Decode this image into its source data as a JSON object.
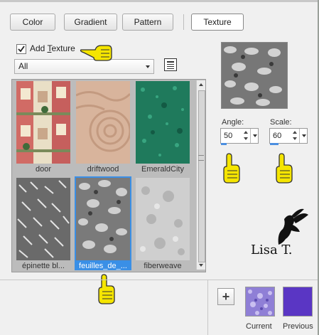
{
  "tabs": [
    {
      "label": "Color"
    },
    {
      "label": "Gradient"
    },
    {
      "label": "Pattern"
    },
    {
      "label": "Texture",
      "active": true
    }
  ],
  "texture": {
    "add_label_prefix": "Add ",
    "add_label_key": "T",
    "add_label_suffix": "exture",
    "checked": true,
    "category": "All"
  },
  "thumbnails": [
    {
      "name": "door",
      "pattern": "door-icon"
    },
    {
      "name": "driftwood",
      "pattern": "driftwood-icon"
    },
    {
      "name": "EmeraldCity",
      "pattern": "emerald-icon"
    },
    {
      "name": "épinette bl...",
      "pattern": "epinette-icon"
    },
    {
      "name": "feuilles_de_...",
      "pattern": "feuilles-icon",
      "selected": true
    },
    {
      "name": "fiberweave",
      "pattern": "fiberweave-icon"
    }
  ],
  "angle": {
    "label": "Angle:",
    "value": "50"
  },
  "scale": {
    "label": "Scale:",
    "value": "60"
  },
  "signature": "Lisa T.",
  "swatches": {
    "current_label": "Current",
    "previous_label": "Previous",
    "current_color": "#8f7fd6",
    "previous_color": "#5a36c4"
  }
}
